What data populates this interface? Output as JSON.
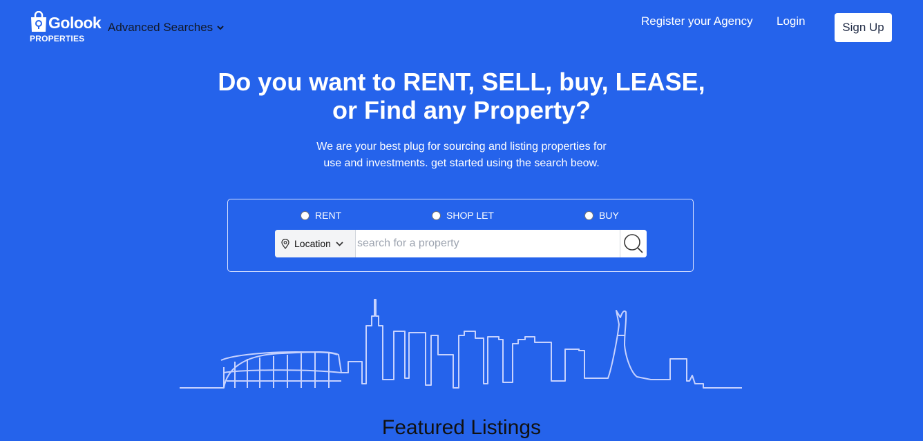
{
  "header": {
    "logo_text": "Golook",
    "logo_sub": "PROPERTIES",
    "advanced_searches": "Advanced Searches",
    "register": "Register your Agency",
    "login": "Login",
    "signup": "Sign Up"
  },
  "hero": {
    "title_line1": "Do you want to RENT, SELL, buy, LEASE,",
    "title_line2": "or Find any Property?",
    "subtitle_line1": "We are your best plug for sourcing and listing properties for",
    "subtitle_line2": "use and investments. get started using the search beow."
  },
  "search": {
    "options": [
      "RENT",
      "SHOP LET",
      "BUY"
    ],
    "location_label": "Location",
    "placeholder": "search for a property"
  },
  "featured_title": "Featured Listings",
  "colors": {
    "background": "#2563eb",
    "text": "#ffffff"
  },
  "icons": [
    "shopping-bag-logo-icon",
    "chevron-down-icon",
    "map-pin-icon",
    "search-icon",
    "skyline-illustration"
  ]
}
